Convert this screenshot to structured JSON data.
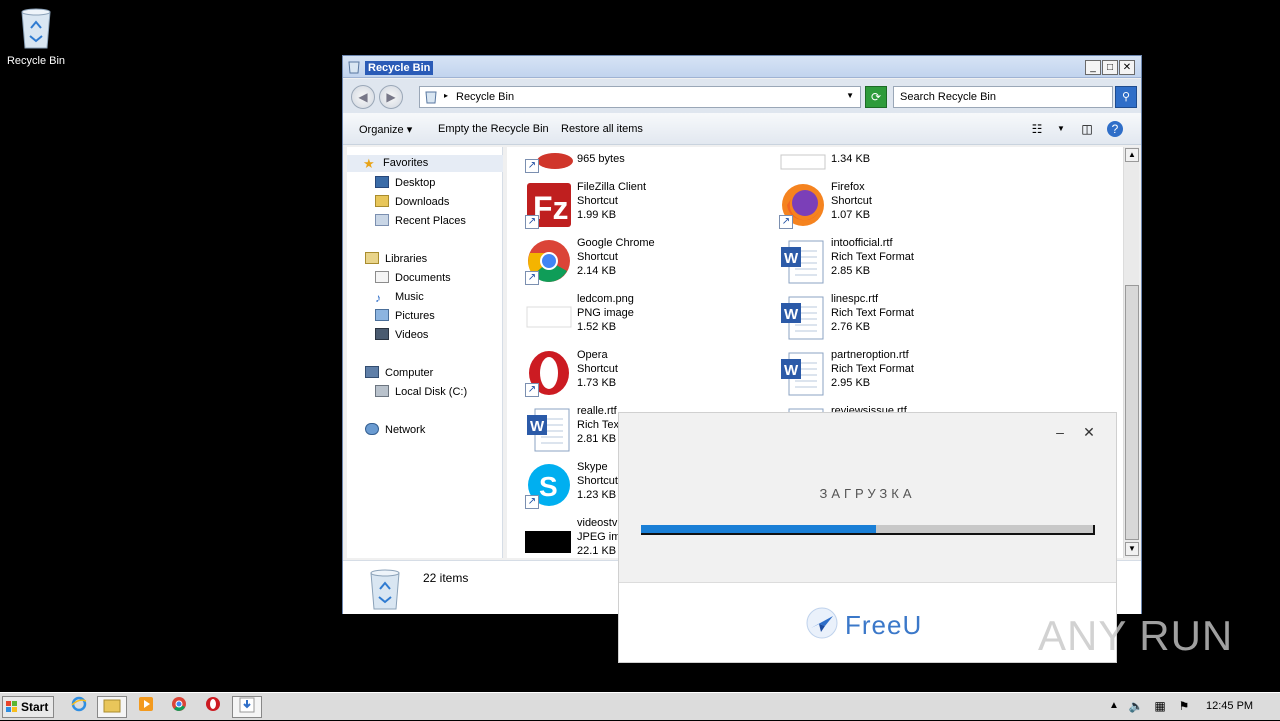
{
  "desktop": {
    "icon_label": "Recycle Bin"
  },
  "window": {
    "title": "Recycle Bin",
    "address": "Recycle Bin",
    "search_placeholder": "Search Recycle Bin",
    "commands": {
      "organize": "Organize",
      "empty": "Empty the Recycle Bin",
      "restore": "Restore all items"
    },
    "nav": {
      "favorites": "Favorites",
      "desktop": "Desktop",
      "downloads": "Downloads",
      "recent": "Recent Places",
      "libraries": "Libraries",
      "documents": "Documents",
      "music": "Music",
      "pictures": "Pictures",
      "videos": "Videos",
      "computer": "Computer",
      "local_disk": "Local Disk (C:)",
      "network": "Network"
    },
    "files": [
      {
        "name": "",
        "type": "",
        "size": "965 bytes"
      },
      {
        "name": "",
        "type": "",
        "size": "1.34 KB"
      },
      {
        "name": "FileZilla Client",
        "type": "Shortcut",
        "size": "1.99 KB"
      },
      {
        "name": "Firefox",
        "type": "Shortcut",
        "size": "1.07 KB"
      },
      {
        "name": "Google Chrome",
        "type": "Shortcut",
        "size": "2.14 KB"
      },
      {
        "name": "intoofficial.rtf",
        "type": "Rich Text Format",
        "size": "2.85 KB"
      },
      {
        "name": "ledcom.png",
        "type": "PNG image",
        "size": "1.52 KB"
      },
      {
        "name": "linespc.rtf",
        "type": "Rich Text Format",
        "size": "2.76 KB"
      },
      {
        "name": "Opera",
        "type": "Shortcut",
        "size": "1.73 KB"
      },
      {
        "name": "partneroption.rtf",
        "type": "Rich Text Format",
        "size": "2.95 KB"
      },
      {
        "name": "realle.rtf",
        "type": "Rich Text",
        "size": "2.81 KB"
      },
      {
        "name": "reviewsissue.rtf",
        "type": "",
        "size": ""
      },
      {
        "name": "Skype",
        "type": "Shortcut",
        "size": "1.23 KB"
      },
      {
        "name": "videostv",
        "type": "JPEG ima",
        "size": "22.1 KB"
      }
    ],
    "item_count": "22 items"
  },
  "loader": {
    "title": "ЗАГРУЗКА",
    "progress": 0.52,
    "brand": "FreeU",
    "accent": "#1a7fd6"
  },
  "watermark": "ANY RUN",
  "taskbar": {
    "start": "Start",
    "clock": "12:45 PM"
  }
}
